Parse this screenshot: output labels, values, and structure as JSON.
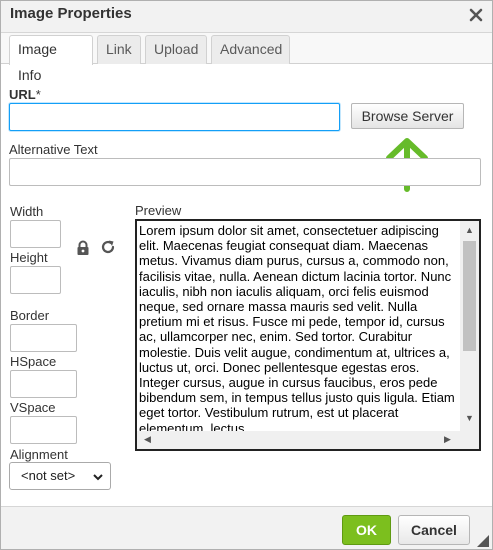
{
  "dialog": {
    "title": "Image Properties"
  },
  "tabs": [
    {
      "label": "Image Info",
      "active": true
    },
    {
      "label": "Link",
      "active": false
    },
    {
      "label": "Upload",
      "active": false
    },
    {
      "label": "Advanced",
      "active": false
    }
  ],
  "url": {
    "label": "URL",
    "required_mark": "*",
    "value": "",
    "browse_label": "Browse Server"
  },
  "alt_text": {
    "label": "Alternative Text",
    "value": ""
  },
  "dimensions": {
    "width_label": "Width",
    "width_value": "",
    "height_label": "Height",
    "height_value": "",
    "border_label": "Border",
    "border_value": "",
    "hspace_label": "HSpace",
    "hspace_value": "",
    "vspace_label": "VSpace",
    "vspace_value": ""
  },
  "alignment": {
    "label": "Alignment",
    "selected": "<not set>"
  },
  "preview": {
    "label": "Preview",
    "text": "Lorem ipsum dolor sit amet, consectetuer adipiscing elit. Maecenas feugiat consequat diam. Maecenas metus. Vivamus diam purus, cursus a, commodo non, facilisis vitae, nulla. Aenean dictum lacinia tortor. Nunc iaculis, nibh non iaculis aliquam, orci felis euismod neque, sed ornare massa mauris sed velit. Nulla pretium mi et risus. Fusce mi pede, tempor id, cursus ac, ullamcorper nec, enim. Sed tortor. Curabitur molestie. Duis velit augue, condimentum at, ultrices a, luctus ut, orci. Donec pellentesque egestas eros. Integer cursus, augue in cursus faucibus, eros pede bibendum sem, in tempus tellus justo quis ligula. Etiam eget tortor. Vestibulum rutrum, est ut placerat elementum, lectus"
  },
  "footer": {
    "ok_label": "OK",
    "cancel_label": "Cancel"
  },
  "colors": {
    "ok_green": "#7cbf1e",
    "arrow_green": "#66bb2a",
    "focus_blue": "#139ff7"
  }
}
